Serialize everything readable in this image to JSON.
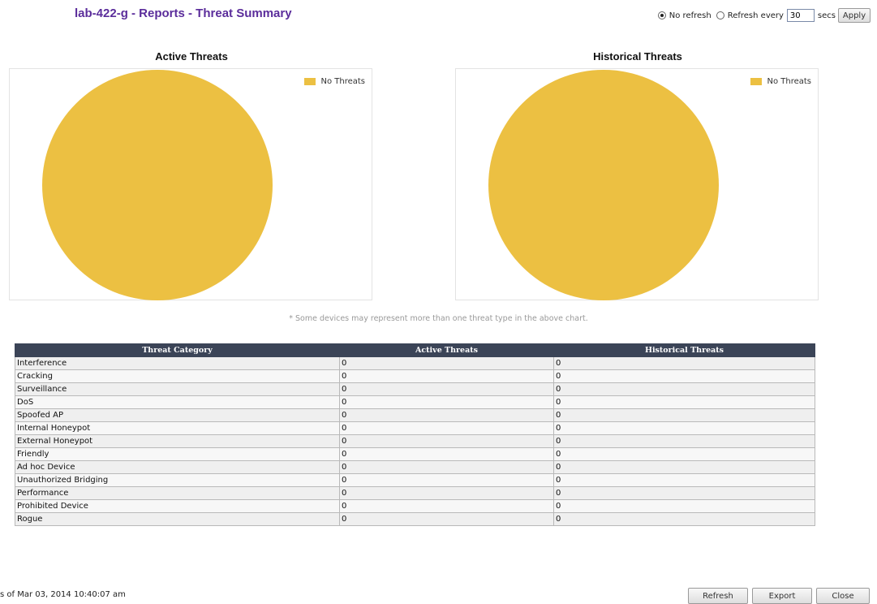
{
  "header": {
    "title": "lab-422-g - Reports - Threat Summary"
  },
  "refresh": {
    "no_refresh_label": "No refresh",
    "no_refresh_selected": true,
    "refresh_every_label": "Refresh every",
    "interval_value": "30",
    "secs_label": "secs",
    "apply_label": "Apply"
  },
  "charts": {
    "active": {
      "title": "Active Threats",
      "legend": "No Threats"
    },
    "historical": {
      "title": "Historical Threats",
      "legend": "No Threats"
    }
  },
  "chart_data": [
    {
      "type": "pie",
      "title": "Active Threats",
      "slices": [
        {
          "label": "No Threats",
          "value": 100,
          "color": "#ecc042"
        }
      ],
      "legend_position": "top-right"
    },
    {
      "type": "pie",
      "title": "Historical Threats",
      "slices": [
        {
          "label": "No Threats",
          "value": 100,
          "color": "#ecc042"
        }
      ],
      "legend_position": "top-right"
    }
  ],
  "note": "* Some devices may represent more than one threat type in the above chart.",
  "table": {
    "headers": [
      "Threat Category",
      "Active Threats",
      "Historical Threats"
    ],
    "rows": [
      [
        "Interference",
        "0",
        "0"
      ],
      [
        "Cracking",
        "0",
        "0"
      ],
      [
        "Surveillance",
        "0",
        "0"
      ],
      [
        "DoS",
        "0",
        "0"
      ],
      [
        "Spoofed AP",
        "0",
        "0"
      ],
      [
        "Internal Honeypot",
        "0",
        "0"
      ],
      [
        "External Honeypot",
        "0",
        "0"
      ],
      [
        "Friendly",
        "0",
        "0"
      ],
      [
        "Ad hoc Device",
        "0",
        "0"
      ],
      [
        "Unauthorized Bridging",
        "0",
        "0"
      ],
      [
        "Performance",
        "0",
        "0"
      ],
      [
        "Prohibited Device",
        "0",
        "0"
      ],
      [
        "Rogue",
        "0",
        "0"
      ]
    ]
  },
  "footer": {
    "timestamp": "s of Mar 03, 2014 10:40:07 am",
    "refresh_label": "Refresh",
    "export_label": "Export",
    "close_label": "Close"
  },
  "colors": {
    "title": "#5b2d9b",
    "table_header": "#3b4457",
    "pie": "#ecc042"
  }
}
